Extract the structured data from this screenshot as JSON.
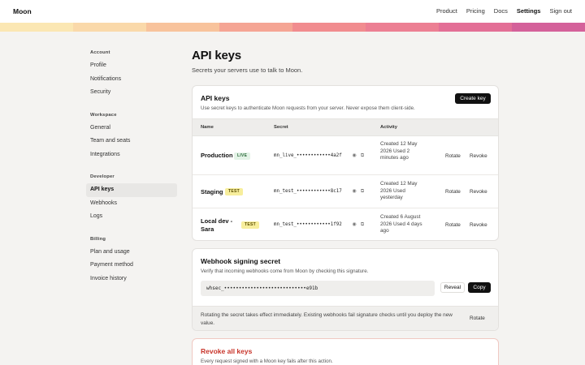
{
  "header": {
    "brand": "Moon",
    "nav": [
      {
        "label": "Product",
        "active": false
      },
      {
        "label": "Pricing",
        "active": false
      },
      {
        "label": "Docs",
        "active": false
      },
      {
        "label": "Settings",
        "active": true
      },
      {
        "label": "Sign out",
        "active": false
      }
    ]
  },
  "stripe_colors": [
    "#fbe7b3",
    "#fad9aa",
    "#f8c39c",
    "#f5a594",
    "#f18c8f",
    "#ec7f93",
    "#e36f96",
    "#d4619a"
  ],
  "sidebar": {
    "groups": [
      {
        "title": "Account",
        "items": [
          {
            "label": "Profile"
          },
          {
            "label": "Notifications"
          },
          {
            "label": "Security"
          }
        ]
      },
      {
        "title": "Workspace",
        "items": [
          {
            "label": "General"
          },
          {
            "label": "Team and seats"
          },
          {
            "label": "Integrations"
          }
        ]
      },
      {
        "title": "Developer",
        "items": [
          {
            "label": "API keys",
            "active": true
          },
          {
            "label": "Webhooks"
          },
          {
            "label": "Logs"
          }
        ]
      },
      {
        "title": "Billing",
        "items": [
          {
            "label": "Plan and usage"
          },
          {
            "label": "Payment method"
          },
          {
            "label": "Invoice history"
          }
        ]
      }
    ]
  },
  "page": {
    "title": "API keys",
    "subtitle": "Secrets your servers use to talk to Moon."
  },
  "keys_card": {
    "title": "API keys",
    "description": "Use secret keys to authenticate Moon requests from your server. Never expose them client-side.",
    "create_label": "Create key",
    "columns": {
      "name": "Name",
      "secret": "Secret",
      "activity": "Activity"
    },
    "rows": [
      {
        "name": "Production",
        "badge": "LIVE",
        "secret": "mn_live_••••••••••••4a2f",
        "activity": "Created 12 May 2026 Used 2 minutes ago",
        "rotate": "Rotate",
        "revoke": "Revoke"
      },
      {
        "name": "Staging",
        "badge": "TEST",
        "secret": "mn_test_••••••••••••8c17",
        "activity": "Created 12 May 2026 Used yesterday",
        "rotate": "Rotate",
        "revoke": "Revoke"
      },
      {
        "name": "Local dev - Sara",
        "badge": "TEST",
        "secret": "mn_test_••••••••••••1f92",
        "activity": "Created 6 August 2026 Used 4 days ago",
        "rotate": "Rotate",
        "revoke": "Revoke"
      }
    ]
  },
  "webhook_card": {
    "title": "Webhook signing secret",
    "description": "Verify that incoming webhooks come from Moon by checking this signature.",
    "secret": "whsec_••••••••••••••••••••••••••••e91b",
    "reveal_label": "Reveal",
    "copy_label": "Copy",
    "notice": "Rotating the secret takes effect immediately. Existing webhooks fail signature checks until you deploy the new value.",
    "rotate_label": "Rotate"
  },
  "danger_card": {
    "title": "Revoke all keys",
    "description": "Every request signed with a Moon key fails after this action.",
    "title_color": "#c8352b",
    "border_color": "#f0c9c2"
  }
}
